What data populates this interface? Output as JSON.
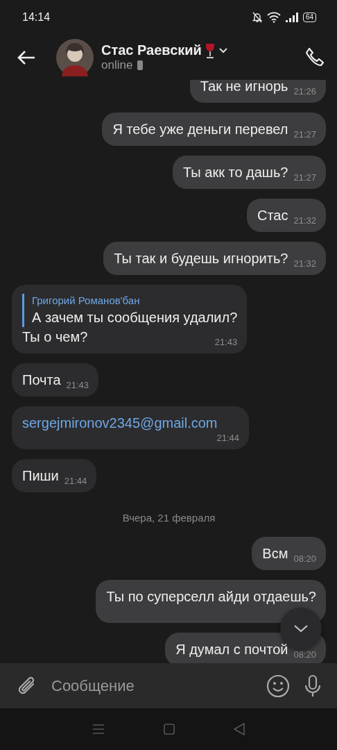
{
  "status_bar": {
    "time": "14:14",
    "battery": "64"
  },
  "header": {
    "name": "Стас Раевский",
    "status": "online"
  },
  "messages": [
    {
      "kind": "outgoing",
      "text": "Так не игнорь",
      "time": "21:26"
    },
    {
      "kind": "outgoing",
      "text": "Я тебе уже деньги перевел",
      "time": "21:27"
    },
    {
      "kind": "outgoing",
      "text": "Ты акк то дашь?",
      "time": "21:27"
    },
    {
      "kind": "outgoing",
      "text": "Стас",
      "time": "21:32"
    },
    {
      "kind": "outgoing",
      "text": "Ты так и будешь игнорить?",
      "time": "21:32"
    },
    {
      "kind": "incoming",
      "reply": {
        "author": "Григорий Романов'бан",
        "text": "А зачем ты сообщения удалил?"
      },
      "text": "Ты о чем?",
      "time": "21:43"
    },
    {
      "kind": "incoming",
      "text": "Почта",
      "time": "21:43"
    },
    {
      "kind": "incoming-link",
      "text": "sergejmironov2345@gmail.com",
      "time": "21:44"
    },
    {
      "kind": "incoming",
      "text": "Пиши",
      "time": "21:44"
    },
    {
      "kind": "date",
      "text": "Вчера, 21 февраля"
    },
    {
      "kind": "outgoing",
      "text": "Всм",
      "time": "08:20"
    },
    {
      "kind": "outgoing",
      "text": "Ты по суперселл айди отдаешь?"
    },
    {
      "kind": "outgoing",
      "text": "Я думал с почтой",
      "time": "08:20"
    }
  ],
  "composer": {
    "placeholder": "Сообщение"
  }
}
